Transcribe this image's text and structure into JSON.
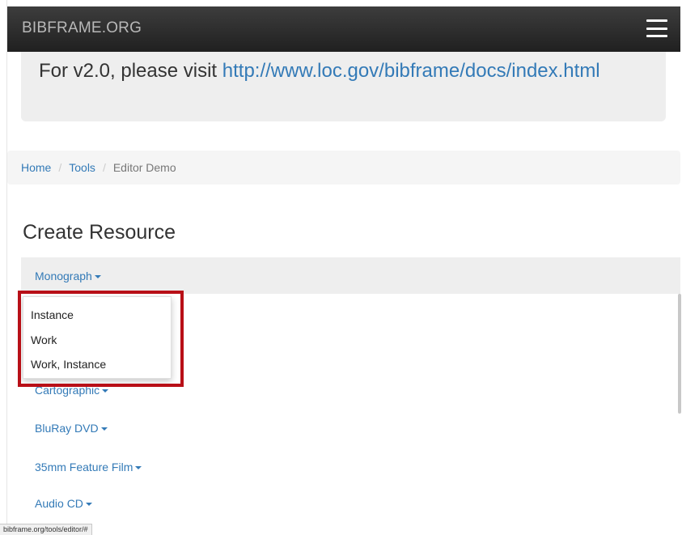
{
  "navbar": {
    "brand": "BIBFRAME.ORG",
    "menu_icon": "hamburger-menu-icon"
  },
  "notice": {
    "prefix": "For v2.0, please visit ",
    "link": "http://www.loc.gov/bibframe/docs/index.html"
  },
  "breadcrumb": {
    "items": [
      "Home",
      "Tools",
      "Editor Demo"
    ],
    "separator": "/"
  },
  "page": {
    "title": "Create Resource"
  },
  "resource_menu": {
    "active": "Monograph",
    "items": [
      "Monograph",
      "Cartographic",
      "BluRay DVD",
      "35mm Feature Film",
      "Audio CD"
    ]
  },
  "dropdown": {
    "items": [
      "Instance",
      "Work",
      "Work, Instance"
    ]
  },
  "status_bar": {
    "url": "bibframe.org/tools/editor/#"
  },
  "colors": {
    "link": "#337ab7",
    "navbar": "#2b2b2b",
    "highlight": "#b80f17"
  }
}
